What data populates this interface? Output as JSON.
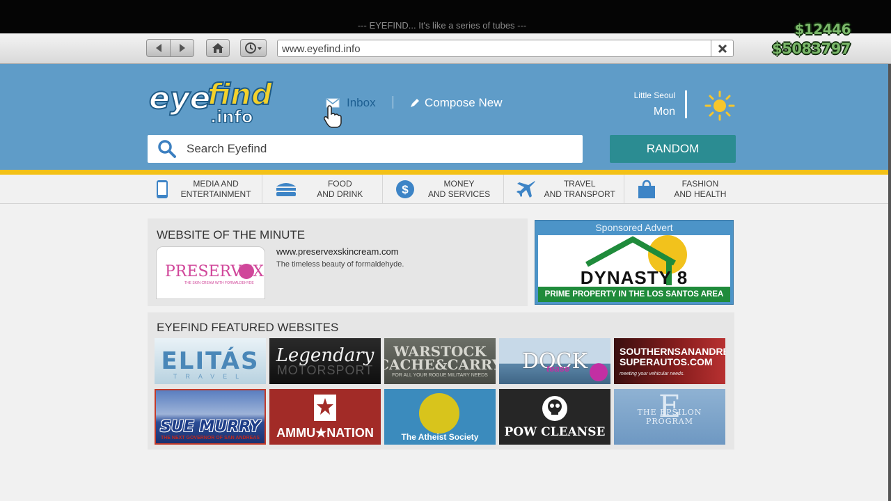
{
  "hud": {
    "tagline": "--- EYEFIND... It's like a series of tubes ---",
    "cash": "$12446",
    "bank": "$5083797"
  },
  "browser": {
    "url": "www.eyefind.info"
  },
  "header": {
    "logo_text": "eyefind.info",
    "inbox_label": "Inbox",
    "compose_label": "Compose New",
    "location": "Little Seoul",
    "day": "Mon",
    "search_placeholder": "Search Eyefind",
    "random_label": "RANDOM"
  },
  "categories": [
    {
      "line1": "MEDIA AND",
      "line2": "ENTERTAINMENT",
      "icon": "phone-icon"
    },
    {
      "line1": "FOOD",
      "line2": "AND DRINK",
      "icon": "burger-icon"
    },
    {
      "line1": "MONEY",
      "line2": "AND SERVICES",
      "icon": "dollar-icon"
    },
    {
      "line1": "TRAVEL",
      "line2": "AND TRANSPORT",
      "icon": "plane-icon"
    },
    {
      "line1": "FASHION",
      "line2": "AND HEALTH",
      "icon": "shopping-bag-icon"
    }
  ],
  "website_of_minute": {
    "title": "WEBSITE OF THE MINUTE",
    "logo_text": "PRESERVEX",
    "logo_sub": "THE SKIN CREAM WITH FORMALDEHYDE",
    "url": "www.preservexskincream.com",
    "description": "The timeless beauty of formaldehyde."
  },
  "sponsored": {
    "heading": "Sponsored Advert",
    "brand": "DYNASTY 8",
    "tagline": "PRIME PROPERTY IN THE LOS SANTOS AREA"
  },
  "featured": {
    "title": "EYEFIND FEATURED WEBSITES",
    "tiles": {
      "elitas": {
        "main": "ELITÁS",
        "sub": "TRAVEL"
      },
      "legendary": {
        "main": "Legendary",
        "sub": "MOTORSPORT"
      },
      "warstock": {
        "main": "WARSTOCK CACHE&CARRY",
        "sub": "FOR ALL YOUR ROGUE MILITARY NEEDS"
      },
      "dock": {
        "main": "DOCK",
        "sub": "tease"
      },
      "ssa": {
        "main": "SOUTHERNSANANDREAS SUPERAUTOS.COM",
        "sub": "meeting your vehicular needs."
      },
      "sue": {
        "main": "SUE MURRY",
        "sub": "THE NEXT GOVERNOR OF SAN ANDREAS"
      },
      "ammu": {
        "main": "AMMU★NATION"
      },
      "atheist": {
        "main": "The Atheist Society"
      },
      "pow": {
        "main": "POW CLEANSE"
      },
      "epsilon": {
        "main": "THE EPSILON PROGRAM"
      }
    }
  },
  "colors": {
    "header_blue": "#5f9cc8",
    "accent_yellow": "#f3c117",
    "random_teal": "#2b8c92",
    "money_green": "#7bb86a"
  }
}
